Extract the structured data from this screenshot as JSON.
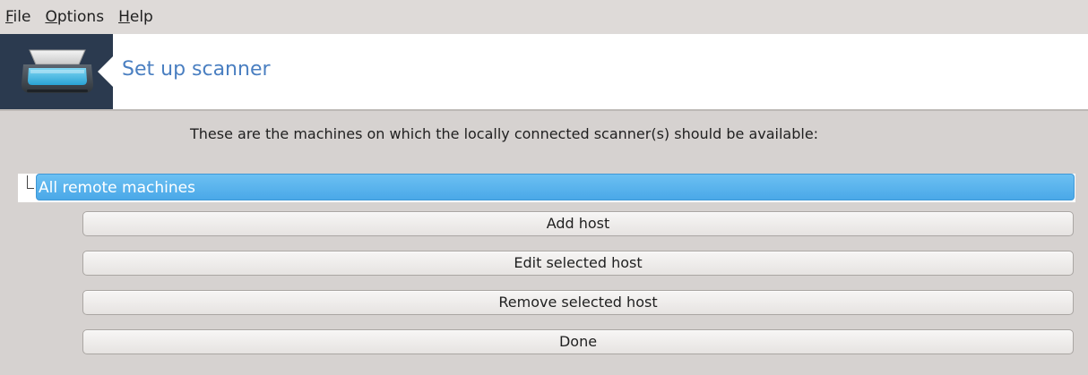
{
  "menubar": {
    "items": [
      {
        "mnemonic": "F",
        "rest": "ile"
      },
      {
        "mnemonic": "O",
        "rest": "ptions"
      },
      {
        "mnemonic": "H",
        "rest": "elp"
      }
    ]
  },
  "banner": {
    "icon": "scanner-icon",
    "title": "Set up scanner"
  },
  "main": {
    "instruction": "These are the machines on which the locally connected scanner(s) should be available:",
    "tree": {
      "selected_item": "All remote machines"
    },
    "buttons": {
      "add": "Add host",
      "edit": "Edit selected host",
      "remove": "Remove selected host",
      "done": "Done"
    }
  },
  "colors": {
    "banner_title": "#4a7fc1",
    "banner_icon_bg": "#2b3a4f",
    "selection": "#4aa8e8",
    "window_bg": "#d6d2d0"
  }
}
